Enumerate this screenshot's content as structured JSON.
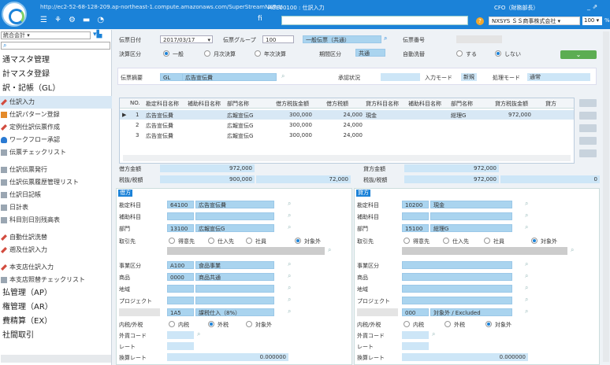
{
  "topbar": {
    "url": "http://ec2-52-68-128-209.ap-northeast-1.compute.amazonaws.com/SuperStreamNXPrt/",
    "page_id": "AGE00100 : 仕訳入力",
    "user": "CFO（財務部長）",
    "company": "NXSYS ＳＳ商事株式会社",
    "zoom": "100",
    "zoom_unit": "%",
    "field_icon": "fi"
  },
  "sidebar": {
    "select": "統合会計",
    "items": [
      {
        "t": "h",
        "label": "通マスタ管理"
      },
      {
        "t": "h",
        "label": "計マスタ登録"
      },
      {
        "t": "h",
        "label": "訳・記帳（GL）"
      },
      {
        "t": "c",
        "label": "仕訳入力",
        "icon": "pencil-icon",
        "sel": true
      },
      {
        "t": "c",
        "label": "仕訳パターン登録",
        "icon": "pattern-icon"
      },
      {
        "t": "c",
        "label": "定例仕訳伝票作成",
        "icon": "pencil-icon"
      },
      {
        "t": "c",
        "label": "ワークフロー承認",
        "icon": "person-icon"
      },
      {
        "t": "c",
        "label": "伝票チェックリスト",
        "icon": "doc-icon"
      },
      {
        "t": "g"
      },
      {
        "t": "c",
        "label": "仕訳伝票発行",
        "icon": "doc-icon"
      },
      {
        "t": "c",
        "label": "仕訳伝票履歴管理リスト",
        "icon": "doc-icon"
      },
      {
        "t": "c",
        "label": "仕訳日記帳",
        "icon": "doc-icon"
      },
      {
        "t": "c",
        "label": "日計表",
        "icon": "doc-icon"
      },
      {
        "t": "c",
        "label": "科目別日別残高表",
        "icon": "doc-icon"
      },
      {
        "t": "g"
      },
      {
        "t": "c",
        "label": "自動仕訳洗替",
        "icon": "pencil-icon"
      },
      {
        "t": "c",
        "label": "遡及仕訳入力",
        "icon": "pencil-icon"
      },
      {
        "t": "g"
      },
      {
        "t": "c",
        "label": "本支店仕訳入力",
        "icon": "pencil-icon"
      },
      {
        "t": "c",
        "label": "本支店照替チェックリスト",
        "icon": "doc-icon"
      },
      {
        "t": "h",
        "label": "払管理（AP）"
      },
      {
        "t": "h",
        "label": "権管理（AR）"
      },
      {
        "t": "h",
        "label": "費精算（EX）"
      },
      {
        "t": "h",
        "label": "社間取引"
      }
    ]
  },
  "header": {
    "date_label": "伝票日付",
    "date": "2017/03/17",
    "group_label": "伝票グループ",
    "group_code": "100",
    "group_name": "一般伝票（共通）",
    "no_label": "伝票番号",
    "settle_label": "決算区分",
    "settle_opts": [
      "一般",
      "月次決算",
      "年次決算"
    ],
    "period_label": "期間区分",
    "period": "共通",
    "auto_label": "自動洗替",
    "auto_opts": [
      "する",
      "しない"
    ],
    "ok": "⌄",
    "summary_label": "伝票摘要",
    "summary_code": "GL",
    "summary_text": "広告宣伝費",
    "approval_label": "承認状況",
    "input_mode_label": "入力モード",
    "input_mode": "新規",
    "process_mode_label": "処理モード",
    "process_mode": "通常"
  },
  "table": {
    "headers": [
      "NO.",
      "勘定科目名称",
      "補助科目名称",
      "部門名称",
      "借方税抜金額",
      "借方税額",
      "貸方科目名称",
      "補助科目名称",
      "部門名称",
      "貸方税抜金額",
      "貸方"
    ],
    "rows": [
      {
        "no": "1",
        "acct": "広告宣伝費",
        "dept": "広報宣伝G",
        "amt": "300,000",
        "tax": "24,000",
        "cacct": "現金",
        "cdept": "総理G",
        "camt": "972,000"
      },
      {
        "no": "2",
        "acct": "広告宣伝費",
        "dept": "広報宣伝G",
        "amt": "300,000",
        "tax": "24,000",
        "cacct": "",
        "cdept": "",
        "camt": ""
      },
      {
        "no": "3",
        "acct": "広告宣伝費",
        "dept": "広報宣伝G",
        "amt": "300,000",
        "tax": "24,000",
        "cacct": "",
        "cdept": "",
        "camt": ""
      }
    ]
  },
  "totals": {
    "debit_label": "借方金額",
    "debit": "972,000",
    "debit_net_label": "税抜/税額",
    "debit_net": "900,000",
    "debit_tax": "72,000",
    "credit_label": "貸方金額",
    "credit": "972,000",
    "credit_net_label": "税抜/税額",
    "credit_net": "972,000",
    "credit_tax": "0"
  },
  "debit": {
    "title": "借方",
    "acct_label": "勘定科目",
    "acct_code": "64100",
    "acct_name": "広告宣伝費",
    "sub_label": "補助科目",
    "dept_label": "部門",
    "dept_code": "13100",
    "dept_name": "広報宣伝G",
    "partner_label": "取引先",
    "partner_opts": [
      "得意先",
      "仕入先",
      "社員",
      "対象外"
    ],
    "biz_label": "事業区分",
    "biz_code": "A100",
    "biz_name": "食品事業",
    "prod_label": "商品",
    "prod_code": "0000",
    "prod_name": "商品共通",
    "area_label": "地域",
    "proj_label": "プロジェクト",
    "tax_code": "1A5",
    "tax_name": "課税仕入（8%）",
    "inout_label": "内税/外税",
    "inout_opts": [
      "内税",
      "外税",
      "対象外"
    ],
    "fx_label": "外貨コード",
    "rate_label": "レート",
    "conv_label": "換算レート",
    "conv": "0.000000"
  },
  "credit": {
    "title": "貸方",
    "acct_label": "勘定科目",
    "acct_code": "10200",
    "acct_name": "現金",
    "sub_label": "補助科目",
    "dept_label": "部門",
    "dept_code": "15100",
    "dept_name": "総理G",
    "partner_label": "取引先",
    "partner_opts": [
      "得意先",
      "仕入先",
      "社員",
      "対象外"
    ],
    "biz_label": "事業区分",
    "prod_label": "商品",
    "area_label": "地域",
    "proj_label": "プロジェクト",
    "tax_code": "000",
    "tax_name": "対象外 / Excluded",
    "inout_label": "内税/外税",
    "inout_opts": [
      "内税",
      "外税",
      "対象外"
    ],
    "fx_label": "外貨コード",
    "rate_label": "レート",
    "conv_label": "換算レート",
    "conv": "0.000000"
  }
}
